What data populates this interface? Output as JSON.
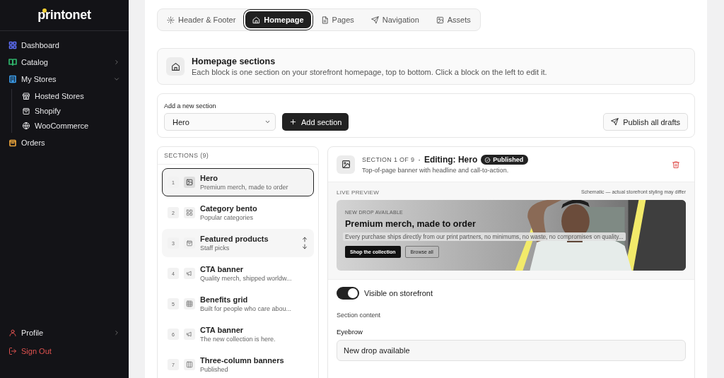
{
  "sidebar": {
    "logo": "printonet",
    "items": [
      {
        "label": "Dashboard",
        "color": "#5b6cf0"
      },
      {
        "label": "Catalog",
        "color": "#2fb36b",
        "expanded": false
      },
      {
        "label": "My Stores",
        "color": "#3b9be8",
        "expanded": true,
        "children": [
          {
            "label": "Hosted Stores"
          },
          {
            "label": "Shopify"
          },
          {
            "label": "WooCommerce"
          }
        ]
      },
      {
        "label": "Orders",
        "color": "#e8a23b"
      }
    ],
    "footer": [
      {
        "label": "Profile",
        "kind": "normal",
        "expanded": false
      },
      {
        "label": "Sign Out",
        "kind": "danger"
      }
    ]
  },
  "tabs": [
    {
      "label": "Header & Footer",
      "selected": false
    },
    {
      "label": "Homepage",
      "selected": true
    },
    {
      "label": "Pages",
      "selected": false
    },
    {
      "label": "Navigation",
      "selected": false
    },
    {
      "label": "Assets",
      "selected": false
    }
  ],
  "intro": {
    "title": "Homepage sections",
    "text": "Each block is one section on your storefront homepage, top to bottom. Click a block on the left to edit it."
  },
  "add_section": {
    "label": "Add a new section",
    "select_value": "Hero",
    "add_button": "Add section",
    "publish_button": "Publish all drafts"
  },
  "sections": {
    "heading": "SECTIONS (9)",
    "items": [
      {
        "number": "1",
        "title": "Hero",
        "subtitle": "Premium merch, made to order",
        "selected": true,
        "hovered": false
      },
      {
        "number": "2",
        "title": "Category bento",
        "subtitle": "Popular categories",
        "selected": false,
        "hovered": false
      },
      {
        "number": "3",
        "title": "Featured products",
        "subtitle": "Staff picks",
        "selected": false,
        "hovered": true
      },
      {
        "number": "4",
        "title": "CTA banner",
        "subtitle": "Quality merch, shipped worldw...",
        "selected": false,
        "hovered": false
      },
      {
        "number": "5",
        "title": "Benefits grid",
        "subtitle": "Built for people who care abou...",
        "selected": false,
        "hovered": false
      },
      {
        "number": "6",
        "title": "CTA banner",
        "subtitle": "The new collection is here.",
        "selected": false,
        "hovered": false
      },
      {
        "number": "7",
        "title": "Three-column banners",
        "subtitle": "Published",
        "selected": false,
        "hovered": false
      }
    ]
  },
  "editor": {
    "position": "SECTION 1 OF 9",
    "separator": "·",
    "title": "Editing: Hero",
    "status": "Published",
    "description": "Top-of-page banner with headline and call-to-action.",
    "preview": {
      "label": "LIVE PREVIEW",
      "note": "Schematic — actual storefront styling may differ",
      "eyebrow": "NEW DROP AVAILABLE",
      "headline": "Premium merch, made to order",
      "body": "Every purchase ships directly from our print partners, no minimums, no waste, no compromises on quality...",
      "primary_button": "Shop the collection",
      "secondary_button": "Browse all"
    },
    "visible": {
      "label": "Visible on storefront",
      "on": true
    },
    "content_label": "Section content",
    "fields": [
      {
        "label": "Eyebrow",
        "value": "New drop available"
      }
    ]
  }
}
